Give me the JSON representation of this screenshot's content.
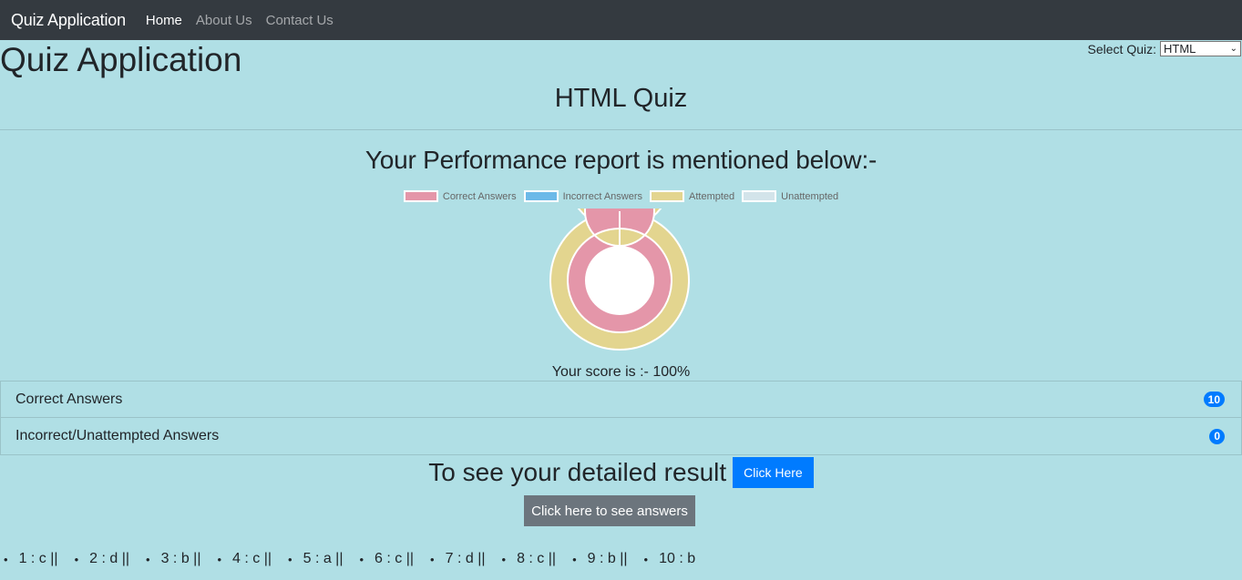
{
  "navbar": {
    "brand": "Quiz Application",
    "links": [
      {
        "label": "Home",
        "active": true
      },
      {
        "label": "About Us",
        "active": false
      },
      {
        "label": "Contact Us",
        "active": false
      }
    ]
  },
  "quiz_select": {
    "label": "Select Quiz:",
    "value": "HTML"
  },
  "page_title": "Quiz Application",
  "quiz_title": "HTML Quiz",
  "report_heading": "Your Performance report is mentioned below:-",
  "chart_data": {
    "type": "pie",
    "subtype": "doughnut",
    "legend_position": "top",
    "legend": [
      {
        "label": "Correct Answers",
        "color": "#e496a9"
      },
      {
        "label": "Incorrect Answers",
        "color": "#6cb9e8"
      },
      {
        "label": "Attempted",
        "color": "#e3d58f"
      },
      {
        "label": "Unattempted",
        "color": "#d3e4ea"
      }
    ],
    "rings": [
      {
        "position": "outer",
        "slices": [
          {
            "label": "Attempted",
            "value": 10
          },
          {
            "label": "Unattempted",
            "value": 0
          }
        ]
      },
      {
        "position": "inner",
        "slices": [
          {
            "label": "Correct Answers",
            "value": 10
          },
          {
            "label": "Incorrect Answers",
            "value": 0
          }
        ]
      }
    ]
  },
  "score_text": "Your score is :- 100%",
  "summary": [
    {
      "label": "Correct Answers",
      "count": "10"
    },
    {
      "label": "Incorrect/Unattempted Answers",
      "count": "0"
    }
  ],
  "detail": {
    "text": "To see your detailed result",
    "button": "Click Here"
  },
  "answers_button": "Click here to see answers",
  "answers": [
    "1 : c ||",
    "2 : d ||",
    "3 : b ||",
    "4 : c ||",
    "5 : a ||",
    "6 : c ||",
    "7 : d ||",
    "8 : c ||",
    "9 : b ||",
    "10 : b"
  ]
}
